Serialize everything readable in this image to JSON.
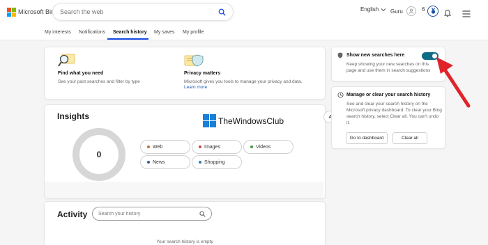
{
  "header": {
    "logo_text": "Microsoft Bing",
    "search_placeholder": "Search the web",
    "language": "English",
    "user_name": "Guru",
    "rewards_count": "6"
  },
  "tabs": [
    {
      "label": "My interests"
    },
    {
      "label": "Notifications"
    },
    {
      "label": "Search history"
    },
    {
      "label": "My saves"
    },
    {
      "label": "My profile"
    }
  ],
  "active_tab": "Search history",
  "info_cards": {
    "find": {
      "title": "Find what you need",
      "text": "See your past searches and filter by type"
    },
    "privacy": {
      "title": "Privacy matters",
      "text": "Microsoft gives you tools to manage your privacy and data.",
      "link": "Learn more"
    }
  },
  "insights": {
    "title": "Insights",
    "filter": "All time",
    "total": "0",
    "categories": [
      {
        "label": "Web",
        "color": "#b8773a"
      },
      {
        "label": "Images",
        "color": "#c4493c"
      },
      {
        "label": "Videos",
        "color": "#3f9a3f"
      },
      {
        "label": "News",
        "color": "#3a5b8f"
      },
      {
        "label": "Shopping",
        "color": "#2a7bb0"
      }
    ]
  },
  "watermark": "TheWindowsClub",
  "activity": {
    "title": "Activity",
    "search_placeholder": "Search your history",
    "empty_text": "Your search history is empty"
  },
  "settings": {
    "show_new": {
      "title": "Show new searches here",
      "text": "Keep showing your new searches on this page and use them in search suggestions",
      "enabled": true
    },
    "manage": {
      "title": "Manage or clear your search history",
      "text": "See and clear your search history on the Microsoft privacy dashboard. To clear your Bing search history, select Clear all. You can't undo it.",
      "dashboard_button": "Go to dashboard",
      "clear_button": "Clear all"
    }
  },
  "colors": {
    "accent": "#174ae4",
    "toggle_on": "#0f6e84",
    "arrow": "#e0242b"
  }
}
